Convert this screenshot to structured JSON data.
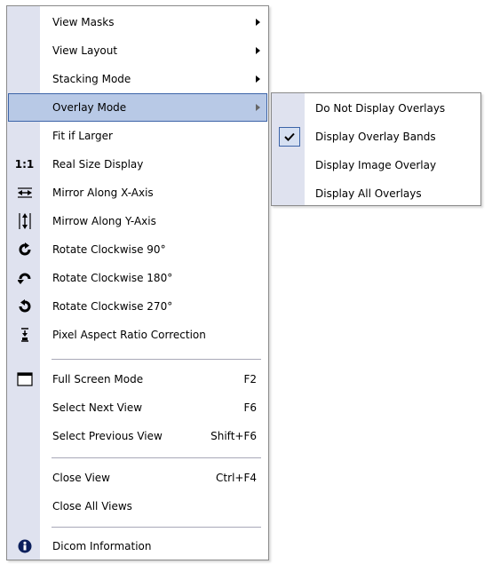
{
  "menu": {
    "items": [
      {
        "label": "View Masks",
        "has_submenu": true,
        "icon": ""
      },
      {
        "label": "View Layout",
        "has_submenu": true,
        "icon": ""
      },
      {
        "label": "Stacking Mode",
        "has_submenu": true,
        "icon": ""
      },
      {
        "label": "Overlay Mode",
        "has_submenu": true,
        "highlighted": true,
        "icon": ""
      },
      {
        "label": "Fit if Larger",
        "icon": ""
      },
      {
        "label": "Real Size Display",
        "icon": "one-to-one-icon",
        "icon_text": "1:1"
      },
      {
        "label": "Mirror Along X-Axis",
        "icon": "mirror-x-icon"
      },
      {
        "label": "Mirrow Along Y-Axis",
        "icon": "mirror-y-icon"
      },
      {
        "label": "Rotate Clockwise 90°",
        "icon": "rotate-90-icon"
      },
      {
        "label": "Rotate Clockwise 180°",
        "icon": "rotate-180-icon"
      },
      {
        "label": "Rotate Clockwise 270°",
        "icon": "rotate-270-icon"
      },
      {
        "label": "Pixel Aspect Ratio Correction",
        "icon": "aspect-ratio-icon"
      },
      {
        "label": "Full Screen Mode",
        "shortcut": "F2",
        "icon": "window-icon"
      },
      {
        "label": "Select Next View",
        "shortcut": "F6",
        "icon": ""
      },
      {
        "label": "Select Previous View",
        "shortcut": "Shift+F6",
        "icon": ""
      },
      {
        "label": "Close View",
        "shortcut": "Ctrl+F4",
        "icon": ""
      },
      {
        "label": "Close All Views",
        "icon": ""
      },
      {
        "label": "Dicom Information",
        "icon": "info-icon"
      }
    ]
  },
  "submenu": {
    "items": [
      {
        "label": "Do Not Display Overlays",
        "checked": false
      },
      {
        "label": "Display Overlay Bands",
        "checked": true
      },
      {
        "label": "Display Image Overlay",
        "checked": false
      },
      {
        "label": "Display All Overlays",
        "checked": false
      }
    ]
  },
  "colors": {
    "gutter": "#dfe2ef",
    "highlight_fill": "#b8c9e6",
    "highlight_border": "#3c64a8"
  }
}
